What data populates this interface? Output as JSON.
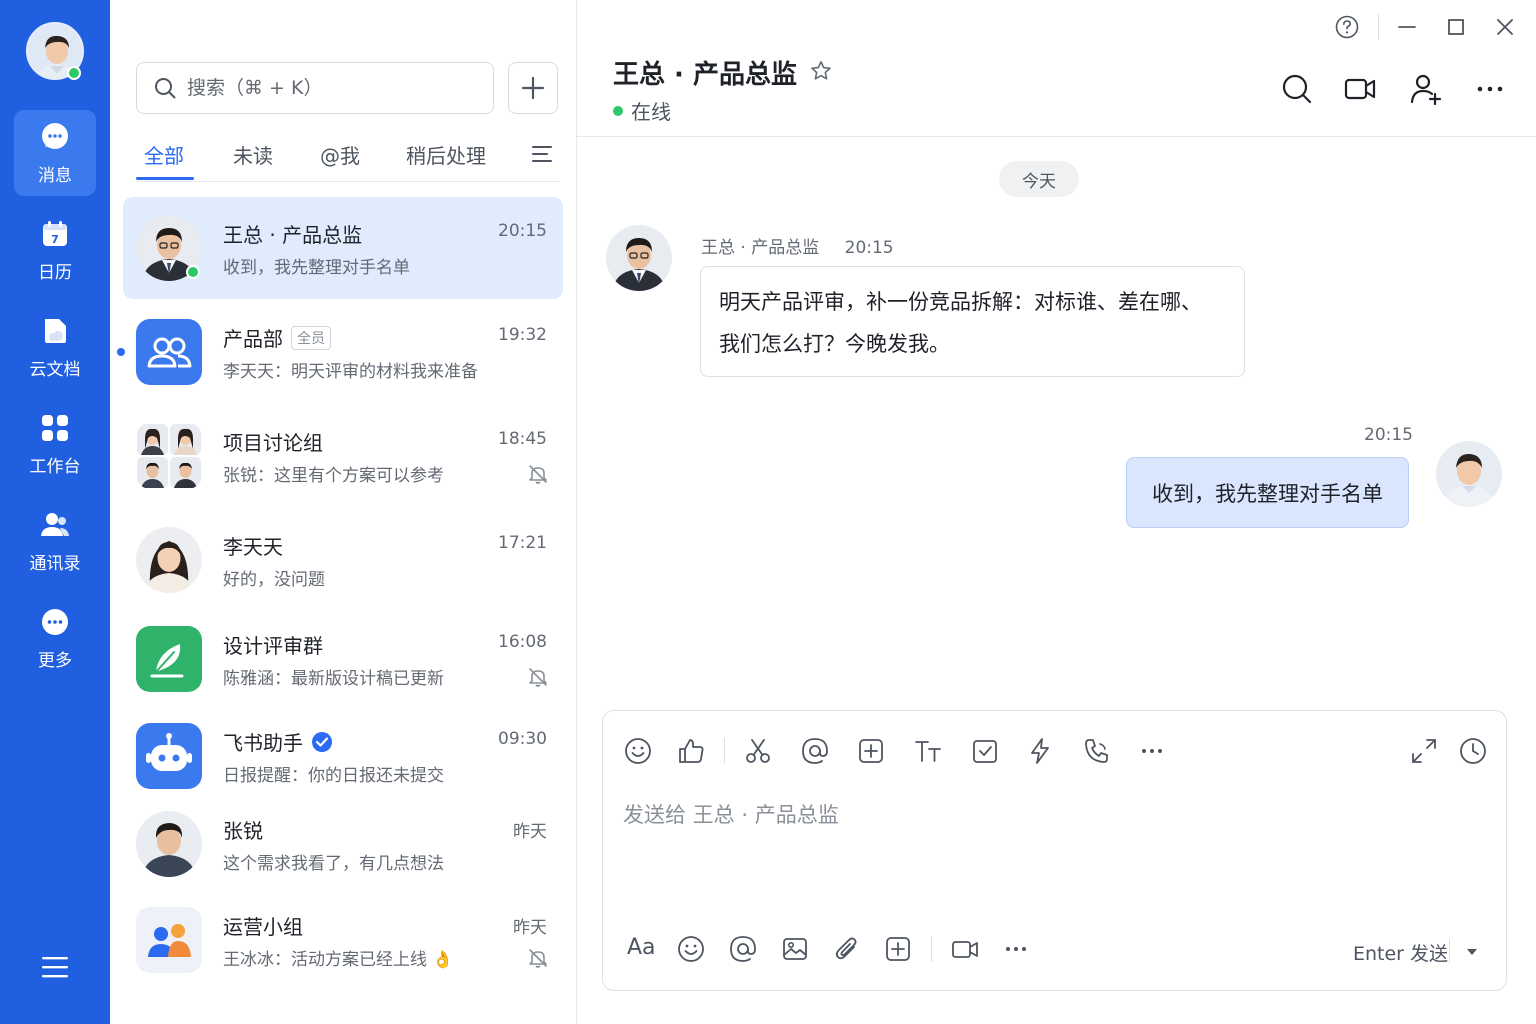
{
  "colors": {
    "rail": "#1f5fe0",
    "accent": "#2a6bf2",
    "online": "#2ec866",
    "selected_row": "#e1ebfe",
    "out_bubble": "#d9e6fd"
  },
  "rail": {
    "items": [
      {
        "label": "消息",
        "icon": "message-icon"
      },
      {
        "label": "日历",
        "icon": "calendar-icon"
      },
      {
        "label": "云文档",
        "icon": "cloud-doc-icon"
      },
      {
        "label": "工作台",
        "icon": "workbench-icon"
      },
      {
        "label": "通讯录",
        "icon": "contacts-icon"
      },
      {
        "label": "更多",
        "icon": "more-icon"
      }
    ]
  },
  "search": {
    "placeholder": "搜索（⌘ + K）"
  },
  "tabs": [
    "全部",
    "未读",
    "@我",
    "稍后处理"
  ],
  "conversations": [
    {
      "name": "王总 · 产品总监",
      "preview": "收到，我先整理对手名单",
      "time": "20:15"
    },
    {
      "name": "产品部",
      "tag": "全员",
      "preview": "李天天：明天评审的材料我来准备",
      "time": "19:32"
    },
    {
      "name": "项目讨论组",
      "preview": "张锐：这里有个方案可以参考",
      "time": "18:45"
    },
    {
      "name": "李天天",
      "preview": "好的，没问题",
      "time": "17:21"
    },
    {
      "name": "设计评审群",
      "preview": "陈雅涵：最新版设计稿已更新",
      "time": "16:08"
    },
    {
      "name": "飞书助手",
      "preview": "日报提醒：你的日报还未提交",
      "time": "09:30"
    },
    {
      "name": "张锐",
      "preview": "这个需求我看了，有几点想法",
      "time": "昨天"
    },
    {
      "name": "运营小组",
      "preview": "王冰冰：活动方案已经上线 👌",
      "time": "昨天"
    }
  ],
  "chat": {
    "title": "王总 · 产品总监",
    "status": "在线",
    "date_divider": "今天",
    "messages": [
      {
        "sender": "王总 · 产品总监",
        "time": "20:15",
        "lines": [
          "明天产品评审，补一份竞品拆解：对标谁、差在哪、",
          "我们怎么打？今晚发我。"
        ]
      },
      {
        "time": "20:15",
        "text": "收到，我先整理对手名单"
      }
    ]
  },
  "composer": {
    "placeholder": "发送给 王总 · 产品总监",
    "format_label": "Aa",
    "send_hint": "Enter 发送"
  }
}
